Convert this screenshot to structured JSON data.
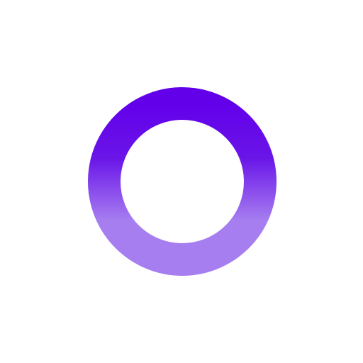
{
  "icon": {
    "name": "ring-icon",
    "colors": {
      "background": "#ffffff",
      "gradient_top": "#6200ea",
      "gradient_mid": "#6a15e8",
      "gradient_bottom": "#a67ef0"
    }
  }
}
